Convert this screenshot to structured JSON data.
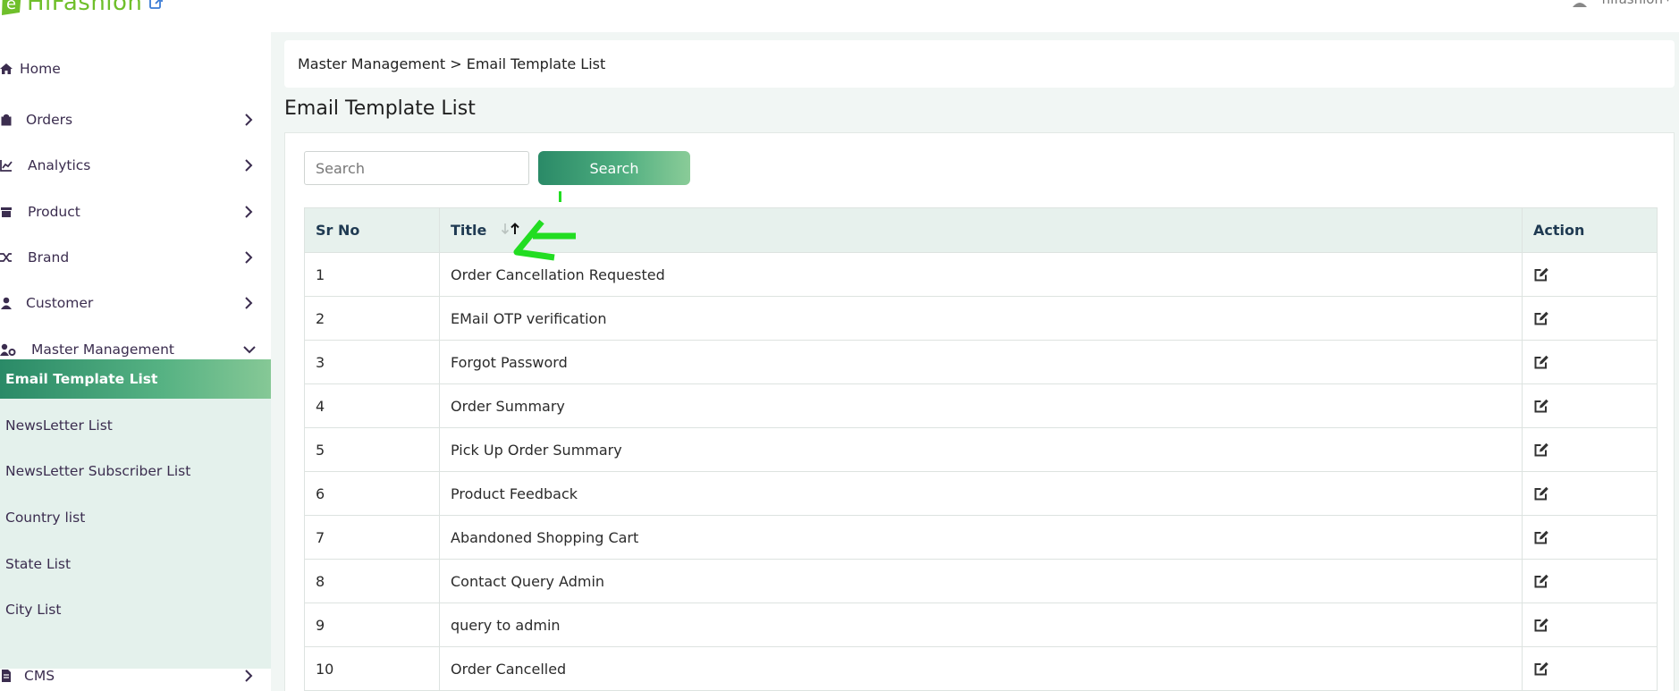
{
  "app": {
    "logo_text": "HiFashion",
    "user_name": "hifashion"
  },
  "sidebar": {
    "items": [
      {
        "label": "Home",
        "icon": "home-icon"
      },
      {
        "label": "Orders",
        "icon": "shopping-bag-icon"
      },
      {
        "label": "Analytics",
        "icon": "chart-line-icon"
      },
      {
        "label": "Product",
        "icon": "box-icon"
      },
      {
        "label": "Brand",
        "icon": "shuffle-icon"
      },
      {
        "label": "Customer",
        "icon": "user-icon"
      },
      {
        "label": "Master Management",
        "icon": "user-cog-icon"
      },
      {
        "label": "CMS",
        "icon": "file-icon"
      }
    ],
    "sub_items": [
      {
        "label": "Email Template List",
        "active": true
      },
      {
        "label": "NewsLetter List"
      },
      {
        "label": "NewsLetter Subscriber List"
      },
      {
        "label": "Country list"
      },
      {
        "label": "State List"
      },
      {
        "label": "City List"
      }
    ]
  },
  "breadcrumb": "Master Management > Email Template List",
  "page_title": "Email Template List",
  "search": {
    "placeholder": "Search",
    "button_label": "Search"
  },
  "table": {
    "headers": {
      "sr": "Sr No",
      "title": "Title",
      "action": "Action"
    },
    "rows": [
      {
        "sr": "1",
        "title": "Order Cancellation Requested"
      },
      {
        "sr": "2",
        "title": "EMail OTP verification"
      },
      {
        "sr": "3",
        "title": "Forgot Password"
      },
      {
        "sr": "4",
        "title": "Order Summary"
      },
      {
        "sr": "5",
        "title": "Pick Up Order Summary"
      },
      {
        "sr": "6",
        "title": "Product Feedback"
      },
      {
        "sr": "7",
        "title": "Abandoned Shopping Cart"
      },
      {
        "sr": "8",
        "title": "Contact Query Admin"
      },
      {
        "sr": "9",
        "title": "query to admin"
      },
      {
        "sr": "10",
        "title": "Order Cancelled"
      }
    ]
  },
  "colors": {
    "accent": "#2a8a67",
    "accent_light": "#86c896",
    "annotation": "#22dd22"
  }
}
